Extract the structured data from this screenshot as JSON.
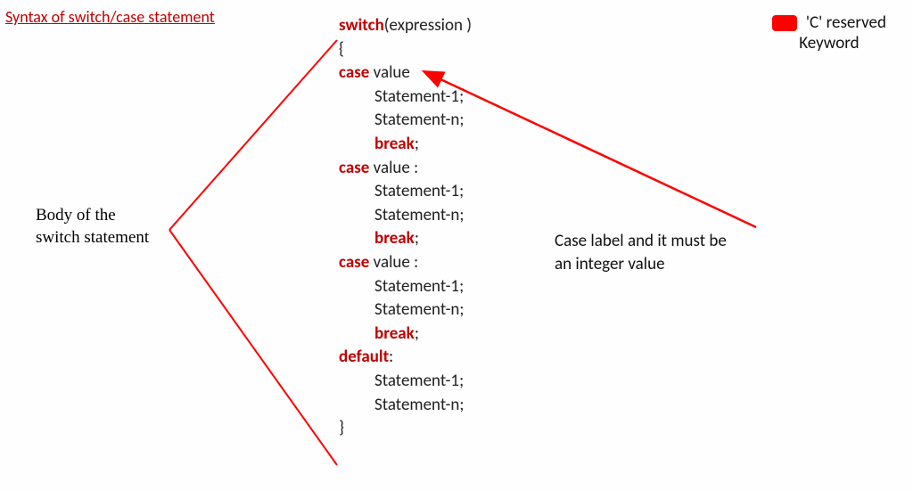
{
  "title": "Syntax of switch/case statement",
  "legend": {
    "line1": "'C' reserved",
    "line2": "Keyword"
  },
  "body_label": {
    "line1": "Body of the",
    "line2": "switch statement"
  },
  "case_label": {
    "line1": "Case label and it must be",
    "line2": "an integer value"
  },
  "code": {
    "switch_kw": "switch",
    "expression": "(expression )",
    "open_brace": "{",
    "case_kw": "case",
    "value1": " value",
    "value_colon": " value :",
    "stmt1": "Statement-1;",
    "stmtn": "Statement-n;",
    "break_kw": "break",
    "semicolon": ";",
    "default_kw": "default",
    "colon": ":",
    "close_brace": "}"
  },
  "colors": {
    "keyword": "#c00000",
    "arrow": "#ff0000"
  }
}
